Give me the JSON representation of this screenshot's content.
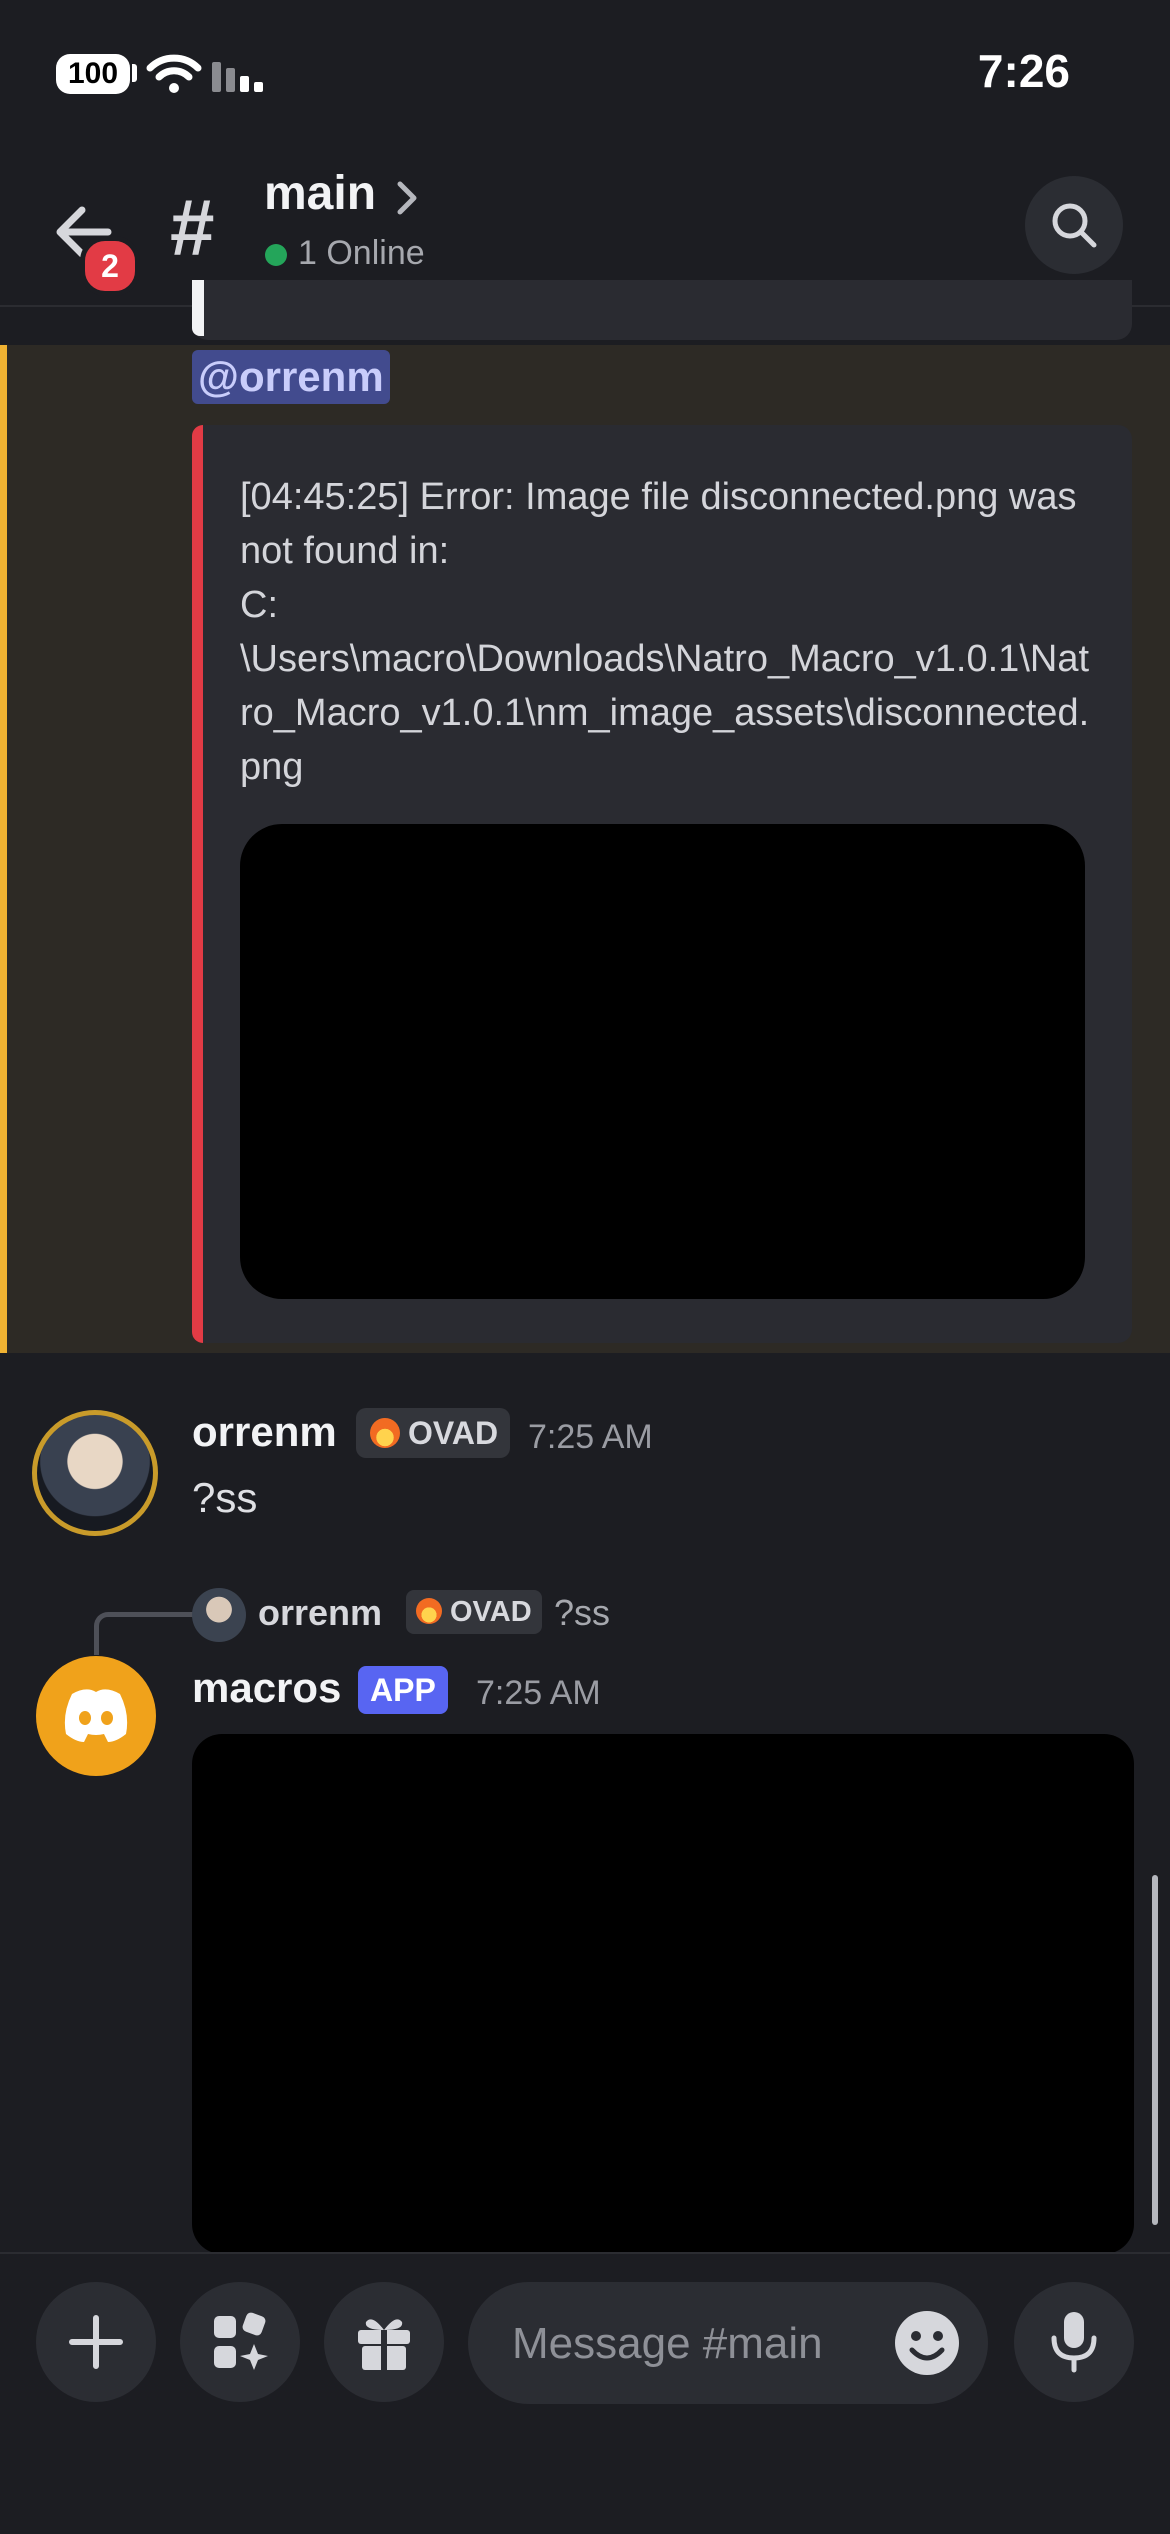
{
  "status_bar": {
    "battery": "100",
    "time": "7:26"
  },
  "header": {
    "back_badge": "2",
    "hash_symbol": "#",
    "channel_name": "main",
    "online_text": "1 Online"
  },
  "mention": {
    "handle": "@orrenm",
    "embed_text": "[04:45:25] Error: Image file disconnected.png was not found in:\nC:\n\\Users\\macro\\Downloads\\Natro_Macro_v1.0.1\\Natro_Macro_v1.0.1\\nm_image_assets\\disconnected.png"
  },
  "messages": [
    {
      "author": "orrenm",
      "tag": "OVAD",
      "time": "7:25 AM",
      "body": "?ss"
    },
    {
      "reply_author": "orrenm",
      "reply_tag": "OVAD",
      "reply_body": "?ss",
      "author": "macros",
      "badge": "APP",
      "time": "7:25 AM"
    }
  ],
  "composer": {
    "placeholder": "Message #main"
  },
  "colors": {
    "accent": "#5865f2",
    "mention_bar": "#f0b232",
    "embed_bar": "#e23b45",
    "online": "#24a55a"
  }
}
